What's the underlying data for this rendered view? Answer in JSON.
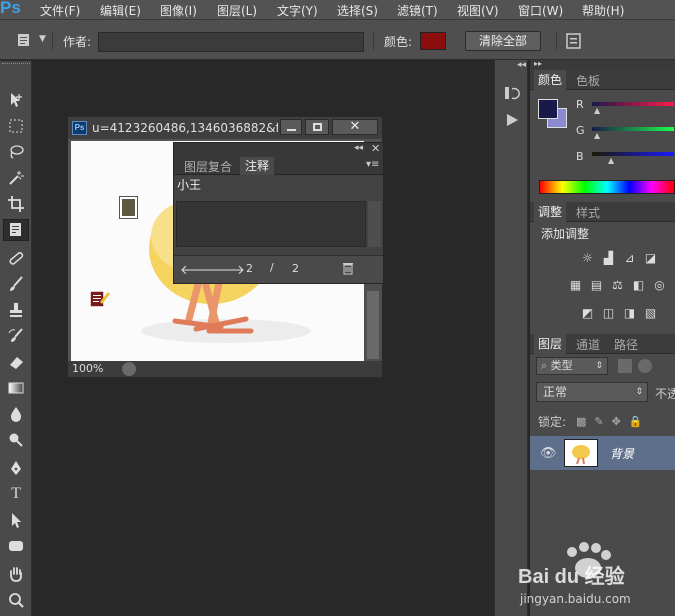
{
  "app": {
    "logo": "Ps"
  },
  "menubar": {
    "items": [
      "文件(F)",
      "编辑(E)",
      "图像(I)",
      "图层(L)",
      "文字(Y)",
      "选择(S)",
      "滤镜(T)",
      "视图(V)",
      "窗口(W)",
      "帮助(H)"
    ]
  },
  "options_bar": {
    "author_label": "作者:",
    "author_value": "",
    "color_label": "颜色:",
    "color_value": "#8b0d0d",
    "clear_all_label": "清除全部"
  },
  "document": {
    "title": "u=4123260486,1346036882&f...",
    "zoom": "100%"
  },
  "notes_panel": {
    "tabs": [
      "图层复合",
      "注释"
    ],
    "active_tab": "注释",
    "note_author": "小王",
    "note_text": "",
    "current": "2",
    "separator": "/",
    "total": "2"
  },
  "color_panel": {
    "tabs": [
      "颜色",
      "色板"
    ],
    "channels": [
      "R",
      "G",
      "B"
    ],
    "fg_color": "#1a1a4a",
    "bg_color": "#8a8ad0"
  },
  "adjustments_panel": {
    "tabs": [
      "调整",
      "样式"
    ],
    "heading": "添加调整"
  },
  "layers_panel": {
    "tabs": [
      "图层",
      "通道",
      "路径"
    ],
    "filter_label": "类型",
    "blend_mode": "正常",
    "opacity_label": "不透",
    "lock_label": "锁定:",
    "layer_name": "背景"
  },
  "watermark": {
    "brand": "Bai du 经验",
    "url": "jingyan.baidu.com"
  }
}
